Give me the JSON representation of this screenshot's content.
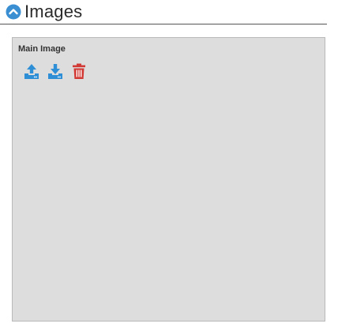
{
  "section": {
    "title": "Images",
    "toggle_icon": "chevron-up-circle-icon"
  },
  "panel": {
    "label": "Main Image",
    "actions": [
      {
        "name": "upload",
        "icon": "upload-icon",
        "color": "#2f8fd6"
      },
      {
        "name": "download",
        "icon": "download-icon",
        "color": "#2f8fd6"
      },
      {
        "name": "delete",
        "icon": "trash-icon",
        "color": "#d23a36"
      }
    ]
  },
  "colors": {
    "accent": "#2f8fd6",
    "danger": "#d23a36",
    "panel_bg": "#dddddd"
  }
}
